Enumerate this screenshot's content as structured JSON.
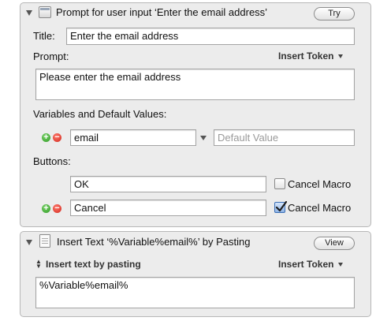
{
  "action1": {
    "title": "Prompt for user input ‘Enter the email address’",
    "try_label": "Try",
    "title_label": "Title:",
    "title_value": "Enter the email address",
    "prompt_label": "Prompt:",
    "insert_token_label": "Insert Token",
    "prompt_value": "Please enter the email address",
    "variables_label": "Variables and Default Values:",
    "variable_name": "email",
    "default_placeholder": "Default Value",
    "buttons_label": "Buttons:",
    "buttons": [
      {
        "label": "OK",
        "cancel_label": "Cancel Macro",
        "cancel_checked": false
      },
      {
        "label": "Cancel",
        "cancel_label": "Cancel Macro",
        "cancel_checked": true
      }
    ]
  },
  "action2": {
    "title": "Insert Text ‘%Variable%email%’ by Pasting",
    "view_label": "View",
    "mode_label": "Insert text by pasting",
    "insert_token_label": "Insert Token",
    "text_value": "%Variable%email%"
  },
  "icons": {
    "disclosure": "disclosure-triangle-icon",
    "action1": "prompt-window-icon",
    "action2": "insert-text-document-icon",
    "add": "plus-circle-icon",
    "remove": "minus-circle-icon",
    "popup": "popup-arrow-icon",
    "checkbox_checked": "checkmark-icon",
    "mode_selector": "up-down-arrows-icon"
  },
  "colors": {
    "panel_bg": "#ececec",
    "add_green": "#2f9a24",
    "remove_red": "#d0251a",
    "checkbox_checked": "#3b6fb6"
  }
}
